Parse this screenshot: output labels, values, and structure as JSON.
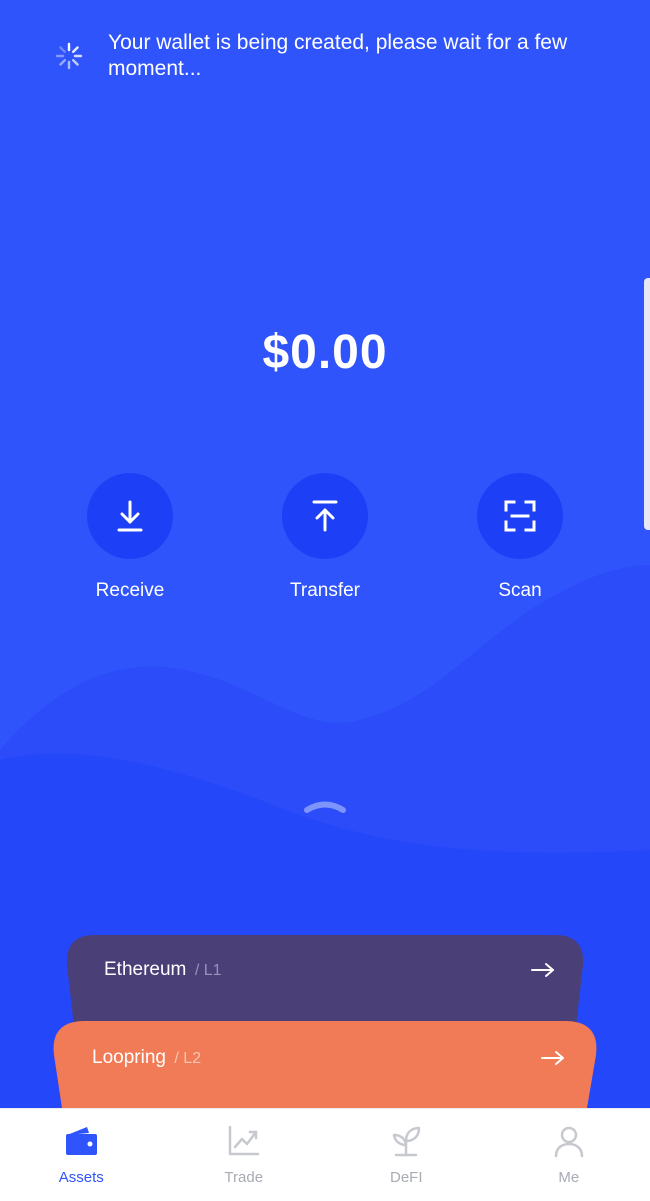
{
  "notice": {
    "text": "Your wallet is being created, please wait for a few moment..."
  },
  "balance": {
    "amount": "$0.00"
  },
  "actions": [
    {
      "id": "receive",
      "label": "Receive",
      "icon": "download-icon"
    },
    {
      "id": "transfer",
      "label": "Transfer",
      "icon": "upload-icon"
    },
    {
      "id": "scan",
      "label": "Scan",
      "icon": "scan-icon"
    }
  ],
  "networks": [
    {
      "name": "Ethereum",
      "layer": "/ L1",
      "color": "#4b3f78"
    },
    {
      "name": "Loopring",
      "layer": "/ L2",
      "color": "#f07b56"
    }
  ],
  "tabs": [
    {
      "id": "assets",
      "label": "Assets",
      "icon": "wallet-icon",
      "active": true
    },
    {
      "id": "trade",
      "label": "Trade",
      "icon": "chart-icon",
      "active": false
    },
    {
      "id": "defi",
      "label": "DeFI",
      "icon": "sprout-icon",
      "active": false
    },
    {
      "id": "me",
      "label": "Me",
      "icon": "user-icon",
      "active": false
    }
  ],
  "colors": {
    "primary": "#2f54fb",
    "deep": "#1d3ff5",
    "inactive": "#a9abb3"
  }
}
